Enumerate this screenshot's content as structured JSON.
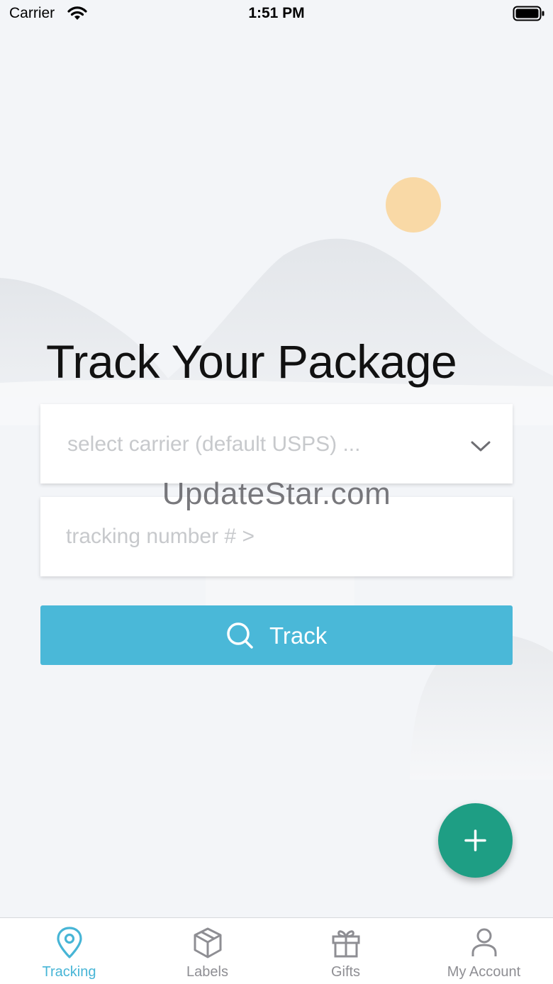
{
  "status_bar": {
    "carrier": "Carrier",
    "time": "1:51 PM"
  },
  "main": {
    "title": "Track Your Package",
    "carrier_select": {
      "placeholder": "select carrier (default USPS) ...",
      "icon": "chevron-down-icon"
    },
    "tracking_input": {
      "placeholder": "tracking number # >",
      "value": ""
    },
    "track_button": {
      "label": "Track",
      "icon": "search-icon"
    },
    "fab": {
      "icon": "plus-icon"
    }
  },
  "watermark": "UpdateStar.com",
  "tab_bar": {
    "tabs": [
      {
        "label": "Tracking",
        "icon": "location-pin-icon",
        "active": true
      },
      {
        "label": "Labels",
        "icon": "box-icon",
        "active": false
      },
      {
        "label": "Gifts",
        "icon": "gift-icon",
        "active": false
      },
      {
        "label": "My Account",
        "icon": "person-icon",
        "active": false
      }
    ]
  },
  "colors": {
    "background": "#f3f5f8",
    "accent": "#4ab8d8",
    "fab": "#1e9e84",
    "sun": "#f9d9a6",
    "tab_active": "#47b5d6",
    "tab_inactive": "#8e8e93"
  }
}
